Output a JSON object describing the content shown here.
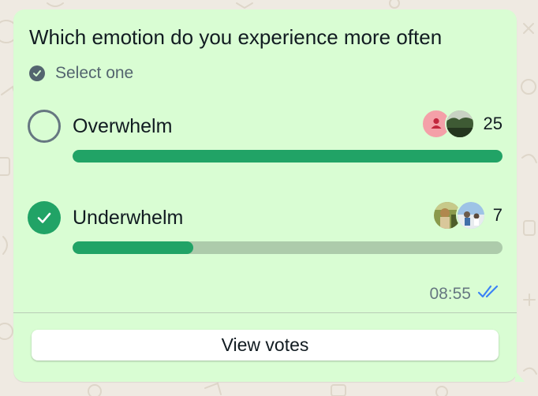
{
  "poll": {
    "question": "Which emotion do you experience more often",
    "instruction": "Select one",
    "options": [
      {
        "label": "Overwhelm",
        "votes": "25",
        "fraction": 1.0,
        "selected": false,
        "voter_avatars": [
          "default-person-avatar",
          "landscape-photo-avatar"
        ]
      },
      {
        "label": "Underwhelm",
        "votes": "7",
        "fraction": 0.28,
        "selected": true,
        "voter_avatars": [
          "outdoor-photo-avatar",
          "beach-photo-avatar"
        ]
      }
    ],
    "time": "08:55",
    "status": "read",
    "view_votes_label": "View votes"
  },
  "colors": {
    "bubble": "#d9fdd3",
    "accent_green": "#21a366",
    "track": "#adcbab",
    "read_ticks": "#3b82f6",
    "muted_text": "#667781"
  }
}
